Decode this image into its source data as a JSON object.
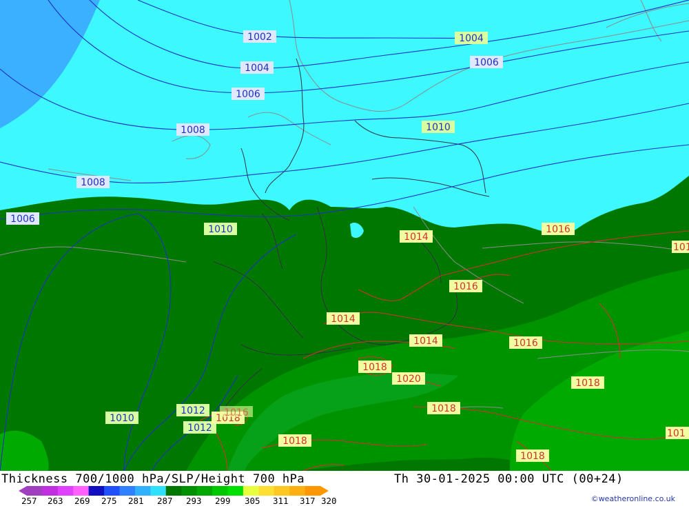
{
  "map": {
    "title": "Thickness 700/1000 hPa/SLP/Height 700 hPa",
    "valid_time": "Th 30-01-2025 00:00 UTC (00+24)",
    "credit": "©weatheronline.co.uk",
    "colors": {
      "deep_sky": "#3ab0ff",
      "cyan": "#3df8ff",
      "dark_green": "#007800",
      "mid_green": "#009600",
      "bright_green": "#00b400",
      "isobar_blue": "#2030c0",
      "isobar_red": "#d03030",
      "border_grey": "#909090"
    },
    "isobar_labels_blue": [
      {
        "id": "b1",
        "text": "1002"
      },
      {
        "id": "b2",
        "text": "1004"
      },
      {
        "id": "b3",
        "text": "1004"
      },
      {
        "id": "b4",
        "text": "1006"
      },
      {
        "id": "b5",
        "text": "1006"
      },
      {
        "id": "b6",
        "text": "1008"
      },
      {
        "id": "b7",
        "text": "1008"
      },
      {
        "id": "b8",
        "text": "1006"
      },
      {
        "id": "b9",
        "text": "1010"
      },
      {
        "id": "b10",
        "text": "1010"
      },
      {
        "id": "b11",
        "text": "1010"
      },
      {
        "id": "b12",
        "text": "1012"
      },
      {
        "id": "b13",
        "text": "1012"
      }
    ],
    "isobar_labels_red": [
      {
        "id": "r1",
        "text": "1014"
      },
      {
        "id": "r2",
        "text": "1016"
      },
      {
        "id": "r3",
        "text": "1016"
      },
      {
        "id": "r4",
        "text": "1014"
      },
      {
        "id": "r5",
        "text": "1014"
      },
      {
        "id": "r6",
        "text": "1016"
      },
      {
        "id": "r7",
        "text": "1018"
      },
      {
        "id": "r8",
        "text": "1020"
      },
      {
        "id": "r9",
        "text": "1018"
      },
      {
        "id": "r10",
        "text": "1018"
      },
      {
        "id": "r11",
        "text": "1018"
      },
      {
        "id": "r12",
        "text": "1018"
      },
      {
        "id": "r13",
        "text": "1018"
      },
      {
        "id": "r14",
        "text": "101"
      },
      {
        "id": "r15",
        "text": "101"
      },
      {
        "id": "r16",
        "text": "1016"
      }
    ],
    "legend": {
      "ticks": [
        "257",
        "263",
        "269",
        "275",
        "281",
        "287",
        "293",
        "299",
        "305",
        "311",
        "317",
        "320"
      ],
      "colors": [
        "#a040c0",
        "#c030e0",
        "#e040ff",
        "#ff60ff",
        "#1010c0",
        "#2050ff",
        "#3080ff",
        "#30b0ff",
        "#30e0ff",
        "#007800",
        "#009000",
        "#00a800",
        "#00c800",
        "#00e000",
        "#e8ff40",
        "#ffe030",
        "#ffc820",
        "#ffb010",
        "#ff9800"
      ]
    }
  }
}
